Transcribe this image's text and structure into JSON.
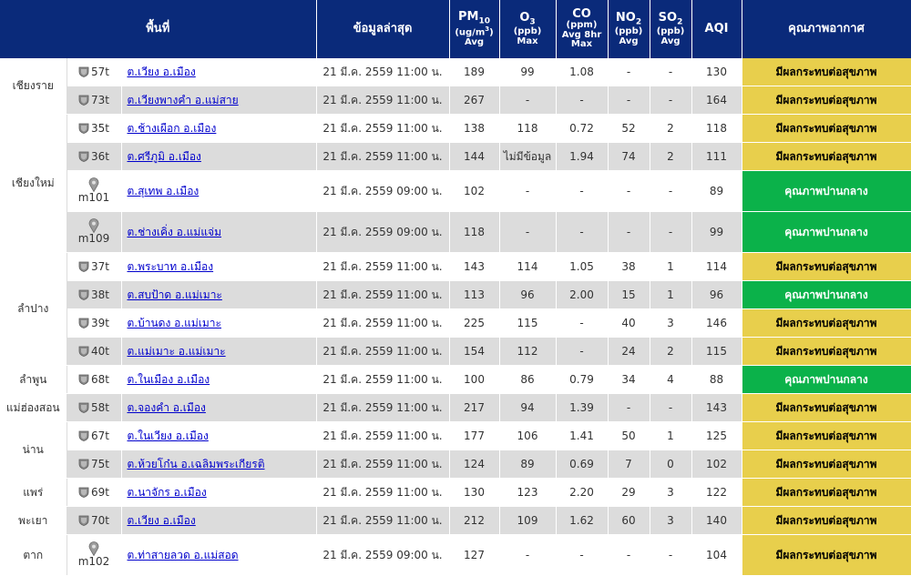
{
  "colors": {
    "header_bg": "#0a2a7a",
    "unhealthy": "#e8cf4c",
    "moderate": "#0bb24a",
    "row_alt": "#dcdcdc",
    "link": "#0000cc"
  },
  "header": {
    "area": "พื้นที่",
    "latest": "ข้อมูลล่าสุด",
    "pm10_main": "PM",
    "pm10_sub": "10",
    "pm10_unit": "(ug/m",
    "pm10_unit_sup": "3",
    "pm10_unit_end": ")",
    "pm10_stat": "Avg",
    "o3_main": "O",
    "o3_sub": "3",
    "o3_unit": "(ppb)",
    "o3_stat": "Max",
    "co_main": "CO",
    "co_unit": "(ppm)",
    "co_stat1": "Avg 8hr",
    "co_stat2": "Max",
    "no2_main": "NO",
    "no2_sub": "2",
    "no2_unit": "(ppb)",
    "no2_stat": "Avg",
    "so2_main": "SO",
    "so2_sub": "2",
    "so2_unit": "(ppb)",
    "so2_stat": "Avg",
    "aqi": "AQI",
    "quality": "คุณภาพอากาศ"
  },
  "provinces": [
    {
      "name": "เชียงราย",
      "start": 0,
      "span": 2
    },
    {
      "name": "เชียงใหม่",
      "start": 2,
      "span": 4
    },
    {
      "name": "ลำปาง",
      "start": 6,
      "span": 4
    },
    {
      "name": "ลำพูน",
      "start": 10,
      "span": 1
    },
    {
      "name": "แม่ฮ่องสอน",
      "start": 11,
      "span": 1
    },
    {
      "name": "น่าน",
      "start": 12,
      "span": 2
    },
    {
      "name": "แพร่",
      "start": 14,
      "span": 1
    },
    {
      "name": "พะเยา",
      "start": 15,
      "span": 1
    },
    {
      "name": "ตาก",
      "start": 16,
      "span": 1
    }
  ],
  "rows": [
    {
      "icon": "shield",
      "code": "57t",
      "loc": "ต.เวียง อ.เมือง",
      "time": "21 มี.ค. 2559 11:00 น.",
      "pm10": "189",
      "o3": "99",
      "co": "1.08",
      "no2": "-",
      "so2": "-",
      "aqi": "130",
      "quality": "มีผลกระทบต่อสุขภาพ",
      "level": "unhealthy"
    },
    {
      "icon": "shield",
      "code": "73t",
      "loc": "ต.เวียงพางคำ อ.แม่สาย",
      "time": "21 มี.ค. 2559 11:00 น.",
      "pm10": "267",
      "o3": "-",
      "co": "-",
      "no2": "-",
      "so2": "-",
      "aqi": "164",
      "quality": "มีผลกระทบต่อสุขภาพ",
      "level": "unhealthy"
    },
    {
      "icon": "shield",
      "code": "35t",
      "loc": "ต.ช้างเผือก อ.เมือง",
      "time": "21 มี.ค. 2559 11:00 น.",
      "pm10": "138",
      "o3": "118",
      "co": "0.72",
      "no2": "52",
      "so2": "2",
      "aqi": "118",
      "quality": "มีผลกระทบต่อสุขภาพ",
      "level": "unhealthy"
    },
    {
      "icon": "shield",
      "code": "36t",
      "loc": "ต.ศรีภูมิ อ.เมือง",
      "time": "21 มี.ค. 2559 11:00 น.",
      "pm10": "144",
      "o3": "ไม่มีข้อมูล",
      "co": "1.94",
      "no2": "74",
      "so2": "2",
      "aqi": "111",
      "quality": "มีผลกระทบต่อสุขภาพ",
      "level": "unhealthy"
    },
    {
      "icon": "pin",
      "code": "m101",
      "loc": "ต.สุเทพ อ.เมือง",
      "time": "21 มี.ค. 2559 09:00 น.",
      "pm10": "102",
      "o3": "-",
      "co": "-",
      "no2": "-",
      "so2": "-",
      "aqi": "89",
      "quality": "คุณภาพปานกลาง",
      "level": "moderate"
    },
    {
      "icon": "pin",
      "code": "m109",
      "loc": "ต.ช่างเคิ่ง อ.แม่แจ่ม",
      "time": "21 มี.ค. 2559 09:00 น.",
      "pm10": "118",
      "o3": "-",
      "co": "-",
      "no2": "-",
      "so2": "-",
      "aqi": "99",
      "quality": "คุณภาพปานกลาง",
      "level": "moderate"
    },
    {
      "icon": "shield",
      "code": "37t",
      "loc": "ต.พระบาท อ.เมือง",
      "time": "21 มี.ค. 2559 11:00 น.",
      "pm10": "143",
      "o3": "114",
      "co": "1.05",
      "no2": "38",
      "so2": "1",
      "aqi": "114",
      "quality": "มีผลกระทบต่อสุขภาพ",
      "level": "unhealthy"
    },
    {
      "icon": "shield",
      "code": "38t",
      "loc": "ต.สบป้าด อ.แม่เมาะ",
      "time": "21 มี.ค. 2559 11:00 น.",
      "pm10": "113",
      "o3": "96",
      "co": "2.00",
      "no2": "15",
      "so2": "1",
      "aqi": "96",
      "quality": "คุณภาพปานกลาง",
      "level": "moderate"
    },
    {
      "icon": "shield",
      "code": "39t",
      "loc": "ต.บ้านดง อ.แม่เมาะ",
      "time": "21 มี.ค. 2559 11:00 น.",
      "pm10": "225",
      "o3": "115",
      "co": "-",
      "no2": "40",
      "so2": "3",
      "aqi": "146",
      "quality": "มีผลกระทบต่อสุขภาพ",
      "level": "unhealthy"
    },
    {
      "icon": "shield",
      "code": "40t",
      "loc": "ต.แม่เมาะ อ.แม่เมาะ",
      "time": "21 มี.ค. 2559 11:00 น.",
      "pm10": "154",
      "o3": "112",
      "co": "-",
      "no2": "24",
      "so2": "2",
      "aqi": "115",
      "quality": "มีผลกระทบต่อสุขภาพ",
      "level": "unhealthy"
    },
    {
      "icon": "shield",
      "code": "68t",
      "loc": "ต.ในเมือง อ.เมือง",
      "time": "21 มี.ค. 2559 11:00 น.",
      "pm10": "100",
      "o3": "86",
      "co": "0.79",
      "no2": "34",
      "so2": "4",
      "aqi": "88",
      "quality": "คุณภาพปานกลาง",
      "level": "moderate"
    },
    {
      "icon": "shield",
      "code": "58t",
      "loc": "ต.จองคำ อ.เมือง",
      "time": "21 มี.ค. 2559 11:00 น.",
      "pm10": "217",
      "o3": "94",
      "co": "1.39",
      "no2": "-",
      "so2": "-",
      "aqi": "143",
      "quality": "มีผลกระทบต่อสุขภาพ",
      "level": "unhealthy"
    },
    {
      "icon": "shield",
      "code": "67t",
      "loc": "ต.ในเวียง อ.เมือง",
      "time": "21 มี.ค. 2559 11:00 น.",
      "pm10": "177",
      "o3": "106",
      "co": "1.41",
      "no2": "50",
      "so2": "1",
      "aqi": "125",
      "quality": "มีผลกระทบต่อสุขภาพ",
      "level": "unhealthy"
    },
    {
      "icon": "shield",
      "code": "75t",
      "loc": "ต.ห้วยโก๋น อ.เฉลิมพระเกียรติ",
      "time": "21 มี.ค. 2559 11:00 น.",
      "pm10": "124",
      "o3": "89",
      "co": "0.69",
      "no2": "7",
      "so2": "0",
      "aqi": "102",
      "quality": "มีผลกระทบต่อสุขภาพ",
      "level": "unhealthy"
    },
    {
      "icon": "shield",
      "code": "69t",
      "loc": "ต.นาจักร อ.เมือง",
      "time": "21 มี.ค. 2559 11:00 น.",
      "pm10": "130",
      "o3": "123",
      "co": "2.20",
      "no2": "29",
      "so2": "3",
      "aqi": "122",
      "quality": "มีผลกระทบต่อสุขภาพ",
      "level": "unhealthy"
    },
    {
      "icon": "shield",
      "code": "70t",
      "loc": "ต.เวียง อ.เมือง",
      "time": "21 มี.ค. 2559 11:00 น.",
      "pm10": "212",
      "o3": "109",
      "co": "1.62",
      "no2": "60",
      "so2": "3",
      "aqi": "140",
      "quality": "มีผลกระทบต่อสุขภาพ",
      "level": "unhealthy"
    },
    {
      "icon": "pin",
      "code": "m102",
      "loc": "ต.ท่าสายลวด อ.แม่สอด",
      "time": "21 มี.ค. 2559 09:00 น.",
      "pm10": "127",
      "o3": "-",
      "co": "-",
      "no2": "-",
      "so2": "-",
      "aqi": "104",
      "quality": "มีผลกระทบต่อสุขภาพ",
      "level": "unhealthy"
    }
  ]
}
